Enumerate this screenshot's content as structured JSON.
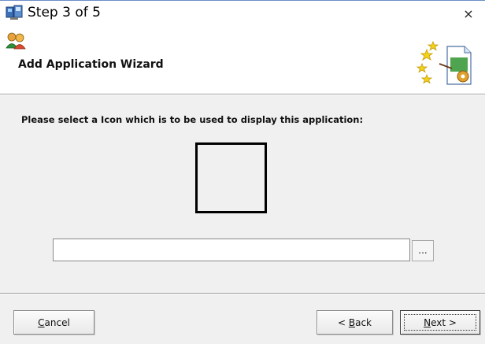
{
  "window": {
    "title": "Step 3 of 5",
    "close_glyph": "×"
  },
  "header": {
    "title": "Add Application Wizard",
    "left_icon": "users-icon",
    "right_icon": "wizard-icon"
  },
  "main": {
    "prompt": "Please select a Icon which is to be used to display this application:",
    "icon_path_value": "",
    "browse_label": "..."
  },
  "footer": {
    "cancel": {
      "mnemonic": "C",
      "rest": "ancel"
    },
    "back": {
      "prefix": "< ",
      "mnemonic": "B",
      "rest": "ack"
    },
    "next": {
      "mnemonic": "N",
      "rest": "ext >"
    }
  }
}
